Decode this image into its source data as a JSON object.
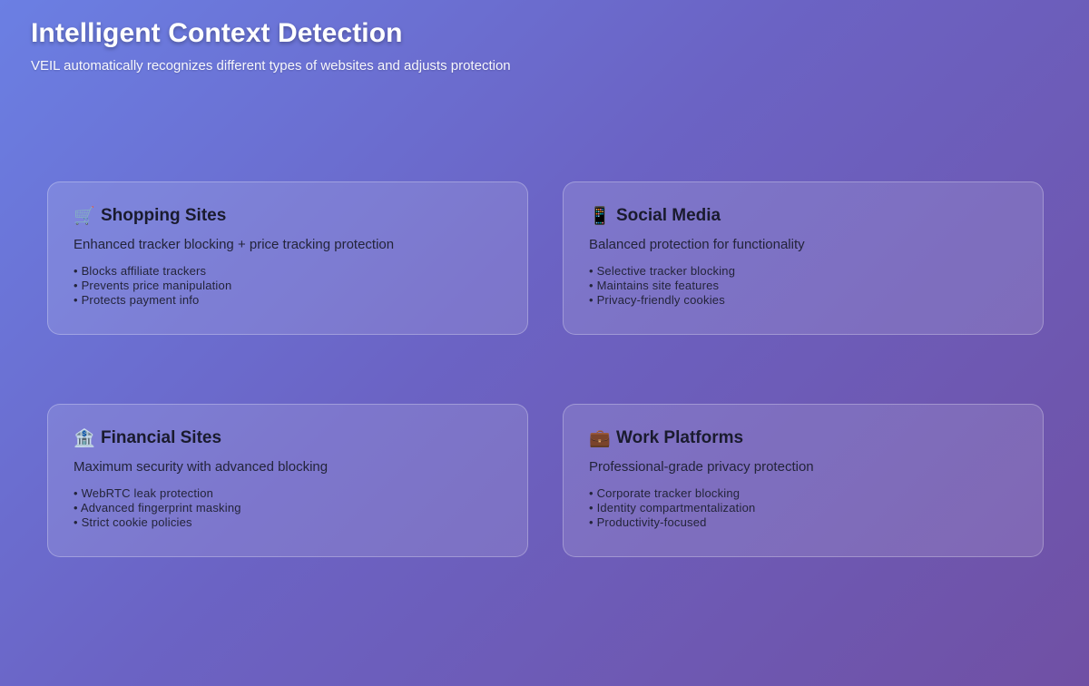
{
  "header": {
    "title": "Intelligent Context Detection",
    "subtitle": "VEIL automatically recognizes different types of websites and adjusts protection"
  },
  "cards": [
    {
      "icon": "shopping-cart-icon",
      "glyph": "🛒",
      "title": "Shopping Sites",
      "description": "Enhanced tracker blocking + price tracking protection",
      "features": [
        "• Blocks affiliate trackers",
        "• Prevents price manipulation",
        "• Protects payment info"
      ]
    },
    {
      "icon": "mobile-phone-icon",
      "glyph": "📱",
      "title": "Social Media",
      "description": "Balanced protection for functionality",
      "features": [
        "• Selective tracker blocking",
        "• Maintains site features",
        "• Privacy-friendly cookies"
      ]
    },
    {
      "icon": "bank-icon",
      "glyph": "🏦",
      "title": "Financial Sites",
      "description": "Maximum security with advanced blocking",
      "features": [
        "• WebRTC leak protection",
        "• Advanced fingerprint masking",
        "• Strict cookie policies"
      ]
    },
    {
      "icon": "briefcase-icon",
      "glyph": "💼",
      "title": "Work Platforms",
      "description": "Professional-grade privacy protection",
      "features": [
        "• Corporate tracker blocking",
        "• Identity compartmentalization",
        "• Productivity-focused"
      ]
    }
  ]
}
